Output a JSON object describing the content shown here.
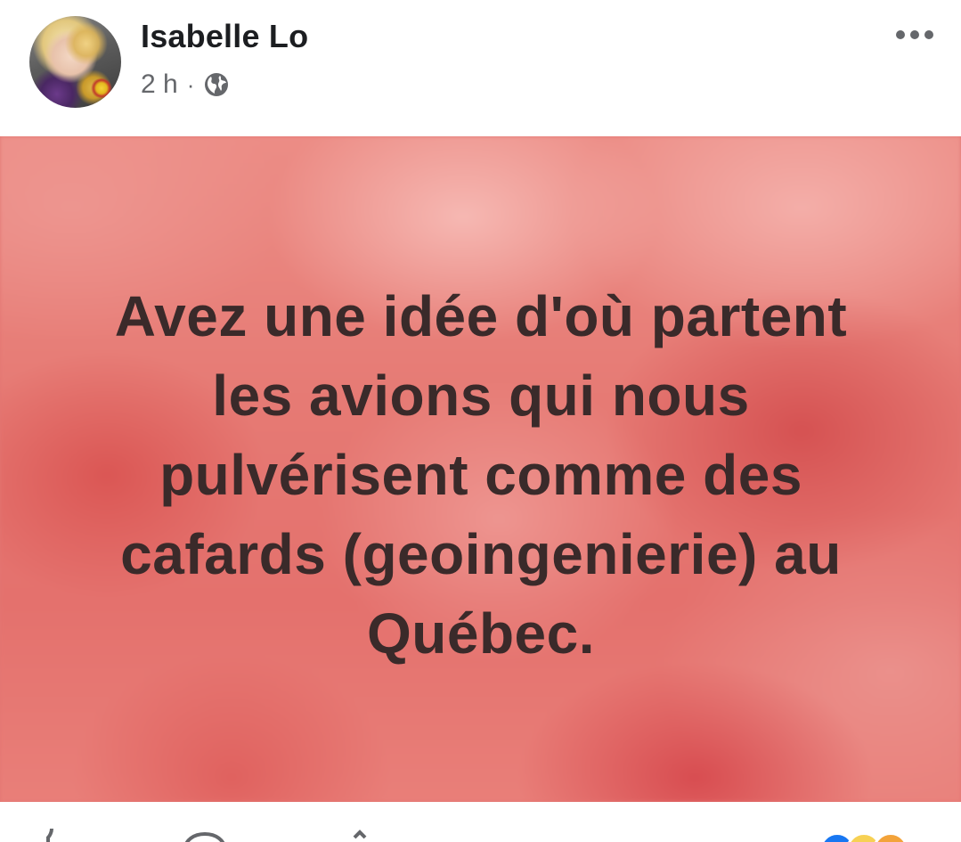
{
  "post": {
    "author": "Isabelle Lo",
    "time": "2 h",
    "separator": "·",
    "privacy_icon": "globe-icon",
    "more_icon": "more-dots-icon",
    "text_lines": [
      "Avez une idée d'où partent",
      "les avions qui nous",
      "pulvérisent comme des",
      "cafards (geoingenierie) au",
      "Québec."
    ],
    "background_color": "#e37672",
    "text_color": "#3a2a2a"
  },
  "action_bar": {
    "icons": [
      "like-icon",
      "comment-icon",
      "share-icon"
    ],
    "reactions": [
      {
        "name": "like-reaction-icon",
        "color": "#1877f2"
      },
      {
        "name": "haha-reaction-icon",
        "color": "#f7d154"
      },
      {
        "name": "love-reaction-icon",
        "color": "#f3a33a"
      }
    ]
  },
  "colors": {
    "name": "#1c1e21",
    "meta": "#65676b"
  }
}
